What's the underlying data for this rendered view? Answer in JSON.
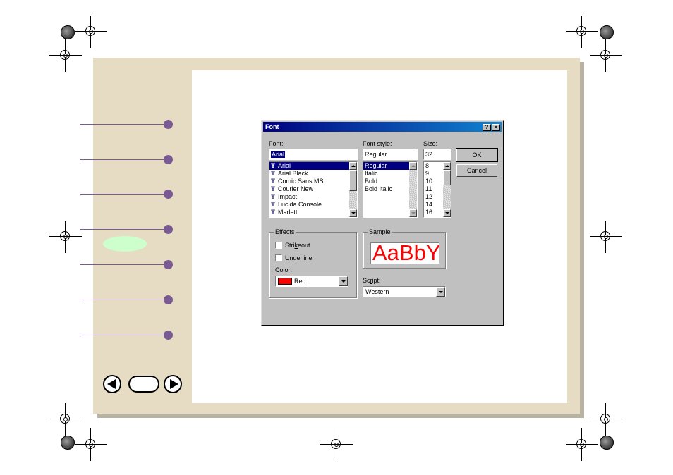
{
  "dialog": {
    "title": "Font",
    "help_button": "?",
    "close_button": "×",
    "font": {
      "label_pre": "",
      "label_key": "F",
      "label_post": "ont:",
      "value": "Arial",
      "items": [
        "Arial",
        "Arial Black",
        "Comic Sans MS",
        "Courier New",
        "Impact",
        "Lucida Console",
        "Marlett"
      ]
    },
    "font_style": {
      "label_pre": "Font st",
      "label_key": "y",
      "label_post": "le:",
      "value": "Regular",
      "items": [
        "Regular",
        "Italic",
        "Bold",
        "Bold Italic"
      ]
    },
    "size": {
      "label_pre": "",
      "label_key": "S",
      "label_post": "ize:",
      "value": "32",
      "items": [
        "8",
        "9",
        "10",
        "11",
        "12",
        "14",
        "16"
      ]
    },
    "ok_label": "OK",
    "cancel_label": "Cancel",
    "effects": {
      "title": "Effects",
      "strikeout_pre": "Stri",
      "strikeout_key": "k",
      "strikeout_post": "eout",
      "underline_pre": "",
      "underline_key": "U",
      "underline_post": "nderline",
      "color_pre": "",
      "color_key": "C",
      "color_post": "olor:",
      "color_value": "Red",
      "color_hex": "#ff0000"
    },
    "sample": {
      "title": "Sample",
      "text": "AaBbYy",
      "color": "#ff0000"
    },
    "script": {
      "label_pre": "Sc",
      "label_key": "r",
      "label_post": "ipt:",
      "value": "Western"
    }
  },
  "colors": {
    "frame": "#e6dcc4",
    "callout": "#7a5a92",
    "highlight": "#ccffcc",
    "titlebar": "#000080"
  }
}
